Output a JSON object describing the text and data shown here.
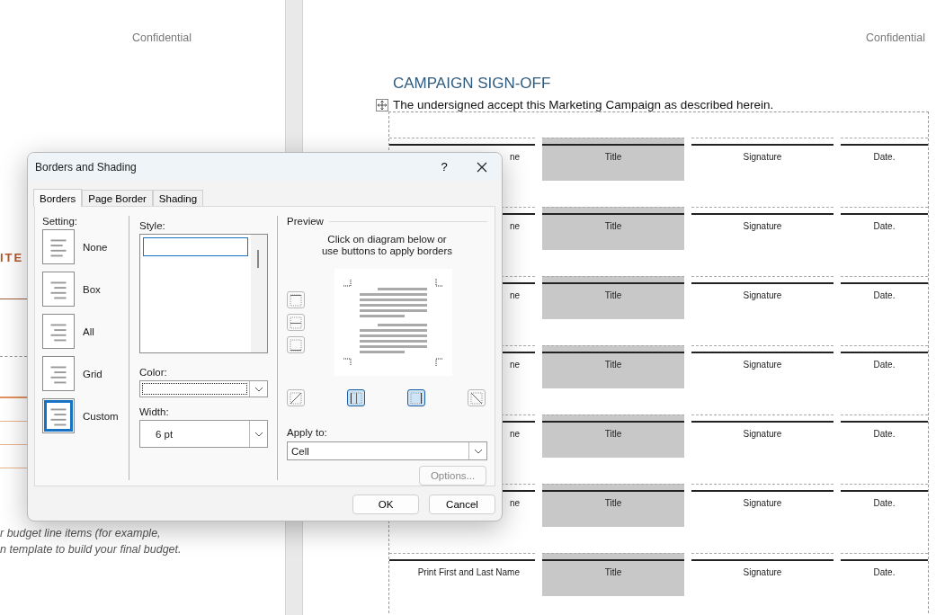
{
  "left_page": {
    "header": "Confidential",
    "heading_fragment": "ITE",
    "note_lines": [
      "r budget line items (for example,",
      "n template to build your final budget."
    ]
  },
  "right_page": {
    "header": "Confidential",
    "title": "CAMPAIGN SIGN-OFF",
    "statement": "The undersigned accept this Marketing Campaign as described herein.",
    "signature_table": {
      "rows": [
        {
          "name": "ne",
          "title": "Title",
          "signature": "Signature",
          "date": "Date."
        },
        {
          "name": "ne",
          "title": "Title",
          "signature": "Signature",
          "date": "Date."
        },
        {
          "name": "ne",
          "title": "Title",
          "signature": "Signature",
          "date": "Date."
        },
        {
          "name": "ne",
          "title": "Title",
          "signature": "Signature",
          "date": "Date."
        },
        {
          "name": "ne",
          "title": "Title",
          "signature": "Signature",
          "date": "Date."
        },
        {
          "name": "ne",
          "title": "Title",
          "signature": "Signature",
          "date": "Date."
        },
        {
          "name": "Print First and Last Name",
          "title": "Title",
          "signature": "Signature",
          "date": "Date."
        }
      ]
    }
  },
  "dialog": {
    "title": "Borders and Shading",
    "help": "?",
    "tabs": [
      {
        "label": "Borders",
        "selected": true
      },
      {
        "label": "Page Border",
        "selected": false
      },
      {
        "label": "Shading",
        "selected": false
      }
    ],
    "setting": {
      "label": "Setting:",
      "options": [
        {
          "label": "None",
          "selected": false
        },
        {
          "label": "Box",
          "selected": false
        },
        {
          "label": "All",
          "selected": false
        },
        {
          "label": "Grid",
          "selected": false
        },
        {
          "label": "Custom",
          "selected": true
        }
      ]
    },
    "style": {
      "label": "Style:"
    },
    "color": {
      "label": "Color:"
    },
    "width": {
      "label": "Width:",
      "value": "6 pt"
    },
    "preview": {
      "label": "Preview",
      "instructions": [
        "Click on diagram below or",
        "use buttons to apply borders"
      ],
      "side_buttons": [
        {
          "on": false
        },
        {
          "on": false
        },
        {
          "on": false
        }
      ],
      "bottom_buttons": [
        {
          "on": false
        },
        {
          "on": true
        },
        {
          "on": true
        },
        {
          "on": false
        }
      ]
    },
    "apply_to": {
      "label": "Apply to:",
      "value": "Cell"
    },
    "options_button": {
      "label": "Options...",
      "disabled": true
    },
    "buttons": [
      "OK",
      "Cancel"
    ]
  }
}
